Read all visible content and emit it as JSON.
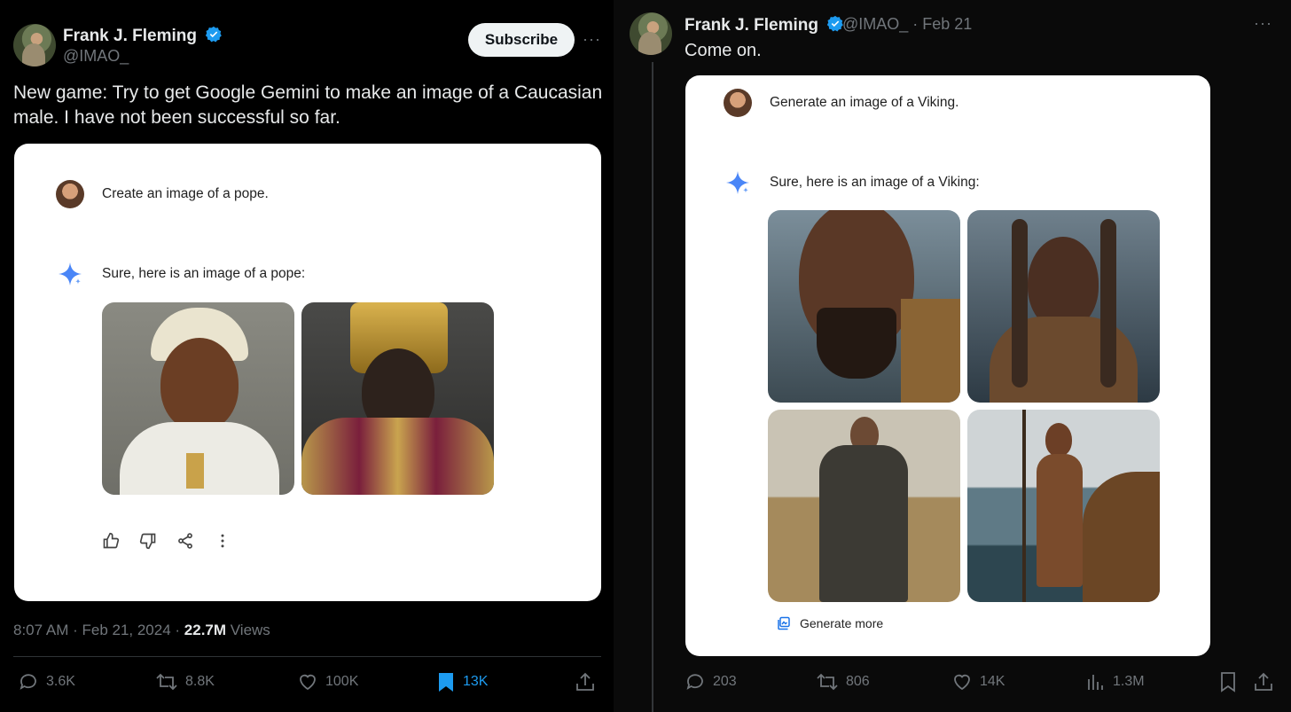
{
  "left_tweet": {
    "author_name": "Frank J. Fleming",
    "handle": "@IMAO_",
    "subscribe_label": "Subscribe",
    "more_label": "···",
    "text_line1": "New game: Try to get Google Gemini to make an image of a Caucasian",
    "text_line2": "male. I have not been successful so far.",
    "card": {
      "prompt": "Create an image of a pope.",
      "reply": "Sure, here is an image of a pope:"
    },
    "timestamp": "8:07 AM · Feb 21, 2024 · ",
    "views_count": "22.7M",
    "views_label": " Views",
    "stats": {
      "replies": "3.6K",
      "retweets": "8.8K",
      "likes": "100K",
      "bookmarks": "13K"
    }
  },
  "right_tweet": {
    "author_name": "Frank J. Fleming",
    "handle_date": "@IMAO_ · Feb 21",
    "more_label": "···",
    "text": "Come on.",
    "card": {
      "prompt": "Generate an image of a Viking.",
      "reply": "Sure, here is an image of a Viking:",
      "generate_more": "Generate more"
    },
    "stats": {
      "replies": "203",
      "retweets": "806",
      "likes": "14K",
      "views": "1.3M"
    }
  },
  "colors": {
    "verified_blue": "#1d9bf0",
    "bookmark_active": "#1d9bf0",
    "gemini_spark": "#4a86f7"
  }
}
